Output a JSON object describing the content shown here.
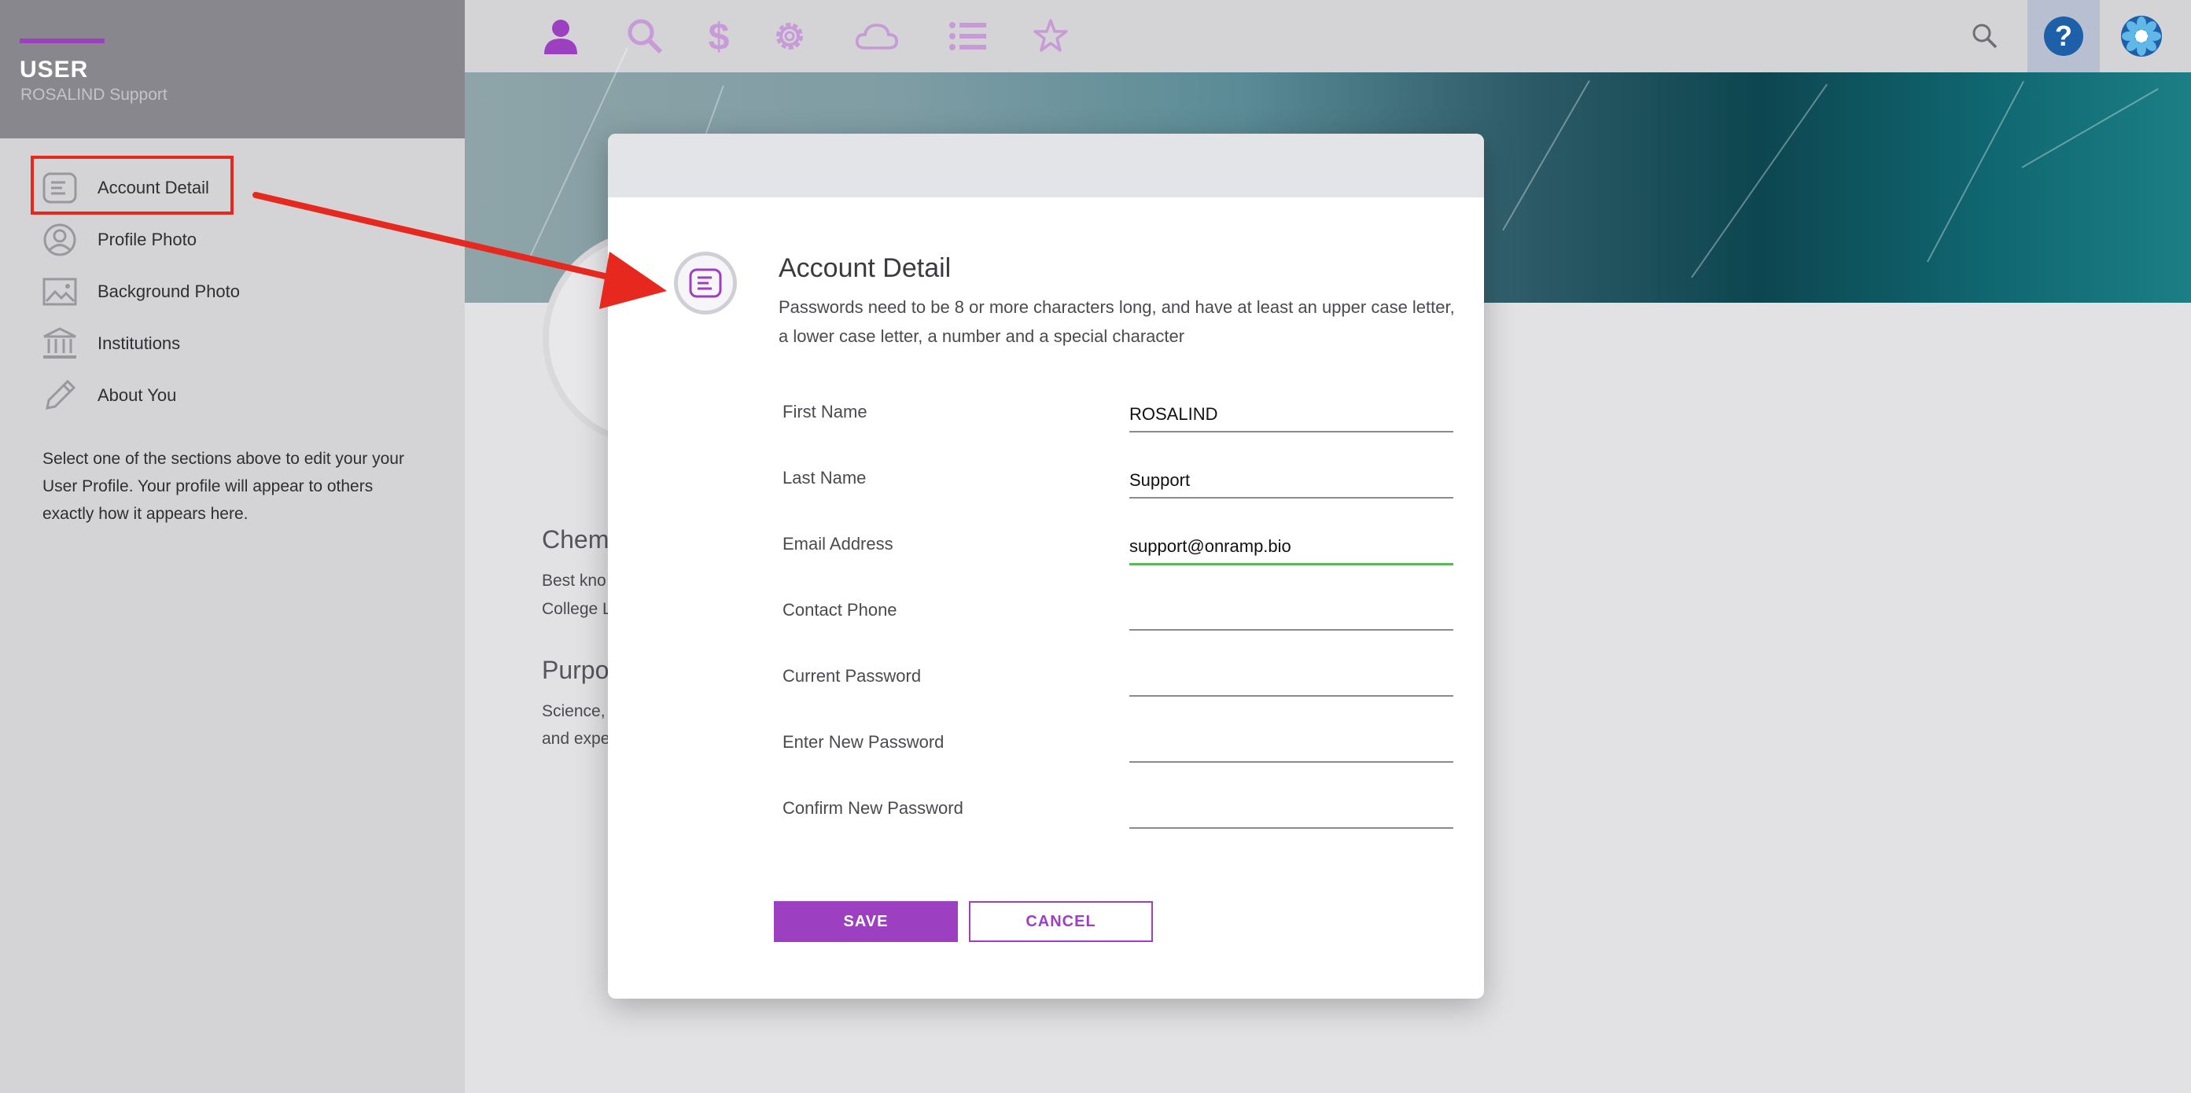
{
  "sidebar": {
    "title": "USER",
    "subtitle": "ROSALIND Support",
    "items": [
      {
        "label": "Account Detail",
        "icon": "document-icon"
      },
      {
        "label": "Profile Photo",
        "icon": "user-circle-icon"
      },
      {
        "label": "Background Photo",
        "icon": "image-icon"
      },
      {
        "label": "Institutions",
        "icon": "institution-icon"
      },
      {
        "label": "About You",
        "icon": "pencil-icon"
      }
    ],
    "help_text": "Select one of the sections above to edit your your User Profile. Your profile will appear to others exactly how it appears here."
  },
  "topbar": {
    "icons": [
      "user-icon",
      "search-icon",
      "dollar-icon",
      "gear-icon",
      "cloud-icon",
      "list-icon",
      "star-icon"
    ],
    "right_icons": [
      "search-icon",
      "help-icon",
      "logo-icon"
    ]
  },
  "background": {
    "section1_title": "Chem",
    "section1_line1": "Best kno",
    "section1_line2": "College L",
    "section2_title": "Purpo",
    "section2_line1": "Science,",
    "section2_line2": "and expe"
  },
  "modal": {
    "title": "Account Detail",
    "description": "Passwords need to be 8 or more characters long, and have at least an upper case letter, a lower case letter, a number and a special character",
    "fields": [
      {
        "label": "First Name",
        "value": "ROSALIND"
      },
      {
        "label": "Last Name",
        "value": "Support"
      },
      {
        "label": "Email Address",
        "value": "support@onramp.bio"
      },
      {
        "label": "Contact Phone",
        "value": ""
      },
      {
        "label": "Current Password",
        "value": ""
      },
      {
        "label": "Enter New Password",
        "value": ""
      },
      {
        "label": "Confirm New Password",
        "value": ""
      }
    ],
    "save_label": "SAVE",
    "cancel_label": "CANCEL"
  },
  "colors": {
    "accent": "#9c3fc1",
    "highlight_red": "#e6281e",
    "active_input": "#5cb85c",
    "help_blue": "#1d5fa8"
  }
}
